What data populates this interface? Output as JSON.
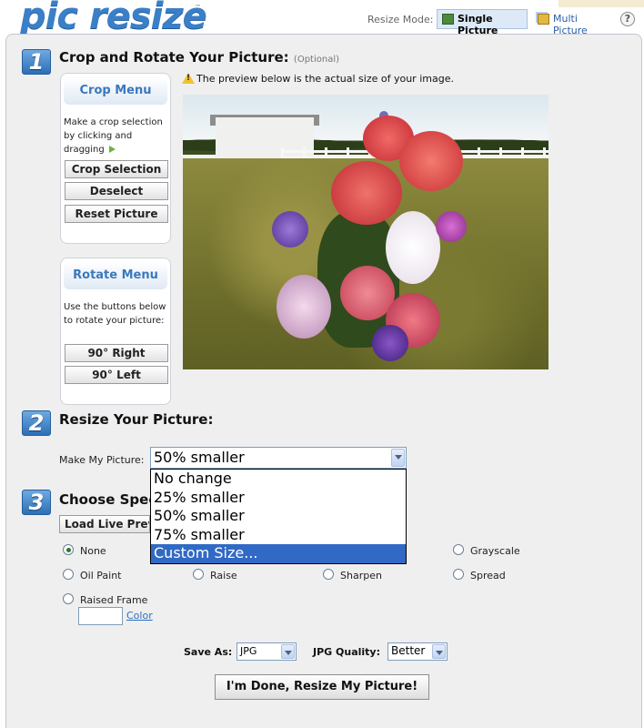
{
  "header": {
    "logo_text": "pic resize",
    "logo_tm": "™",
    "resize_mode_label": "Resize Mode:",
    "single_label": "Single Picture",
    "multi_label": "Multi Picture",
    "help_label": "?"
  },
  "step1": {
    "number": "1",
    "title": "Crop and Rotate Your Picture:",
    "optional": "(Optional)",
    "preview_note": "The preview below is the actual size of your image.",
    "crop_menu": {
      "title": "Crop Menu",
      "description": "Make a crop selection by clicking and dragging",
      "buttons": [
        "Crop Selection",
        "Deselect",
        "Reset Picture"
      ]
    },
    "rotate_menu": {
      "title": "Rotate Menu",
      "description": "Use the buttons below to rotate your picture:",
      "buttons": [
        "90° Right",
        "90° Left"
      ]
    }
  },
  "step2": {
    "number": "2",
    "title": "Resize Your Picture:",
    "make_label": "Make My Picture:",
    "selected_value": "50% smaller",
    "options": [
      "No change",
      "25% smaller",
      "50% smaller",
      "75% smaller",
      "Custom Size..."
    ],
    "highlighted_option": "Custom Size..."
  },
  "step3": {
    "number": "3",
    "title": "Choose Speci",
    "live_button": "Load Live Prev",
    "effects": [
      {
        "label": "None",
        "checked": true
      },
      {
        "label": "Grayscale",
        "checked": false
      },
      {
        "label": "Oil Paint",
        "checked": false
      },
      {
        "label": "Raise",
        "checked": false
      },
      {
        "label": "Sharpen",
        "checked": false
      },
      {
        "label": "Spread",
        "checked": false
      },
      {
        "label": "Raised Frame",
        "checked": false
      }
    ],
    "color_link": "Color",
    "save_as_label": "Save As:",
    "save_as_value": "JPG",
    "quality_label": "JPG Quality:",
    "quality_value": "Better",
    "done_button": "I'm Done, Resize My Picture!"
  },
  "colors": {
    "accent_blue": "#3a78be",
    "selection_blue": "#316ac5",
    "panel_bg": "#efefef"
  },
  "icons": [
    "single-picture-icon",
    "multi-picture-icon",
    "help-icon",
    "warning-icon",
    "arrow-right-icon",
    "dropdown-arrow-icon"
  ]
}
